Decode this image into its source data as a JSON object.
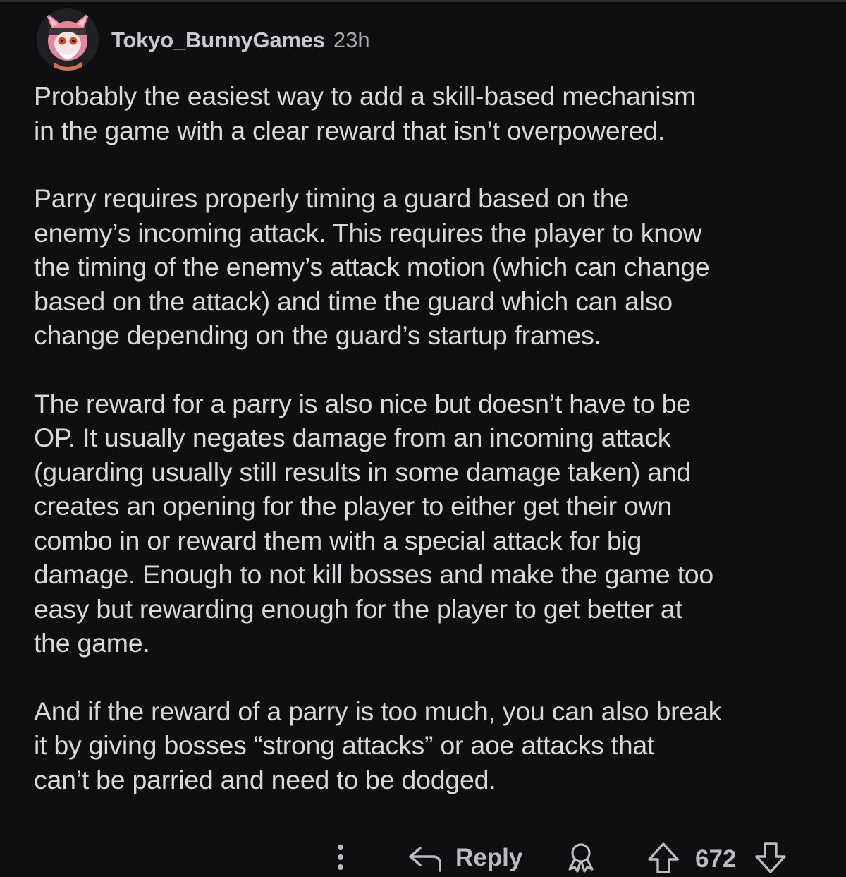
{
  "comment": {
    "author": "Tokyo_BunnyGames",
    "age": "23h",
    "paragraphs": [
      "Probably the easiest way to add a skill-based mechanism\nin the game with a clear reward that isn’t overpowered.",
      "Parry requires properly timing a guard based on the\nenemy’s incoming attack. This requires the player to know\nthe timing of the enemy’s attack motion (which can change\nbased on the attack) and time the guard which can also\nchange depending on the guard’s startup frames.",
      "The reward for a parry is also nice but doesn’t have to be\nOP. It usually negates damage from an incoming attack\n(guarding usually still results in some damage taken) and\ncreates an opening for the player to either get their own\ncombo in or reward them with a special attack for big\ndamage. Enough to not kill bosses and make the game too\neasy but rewarding enough for the player to get better at\nthe game.",
      "And if the reward of a parry is too much, you can also break\nit by giving bosses “strong attacks” or aoe attacks that\ncan’t be parried and need to be dodged."
    ]
  },
  "actions": {
    "reply_label": "Reply",
    "score": "672",
    "icons": [
      "more-vertical-icon",
      "reply-arrow-icon",
      "award-icon",
      "upvote-icon",
      "downvote-icon"
    ]
  },
  "colors": {
    "background": "#0e0f11",
    "text": "#d7dadc",
    "muted": "#b9bdc1"
  }
}
